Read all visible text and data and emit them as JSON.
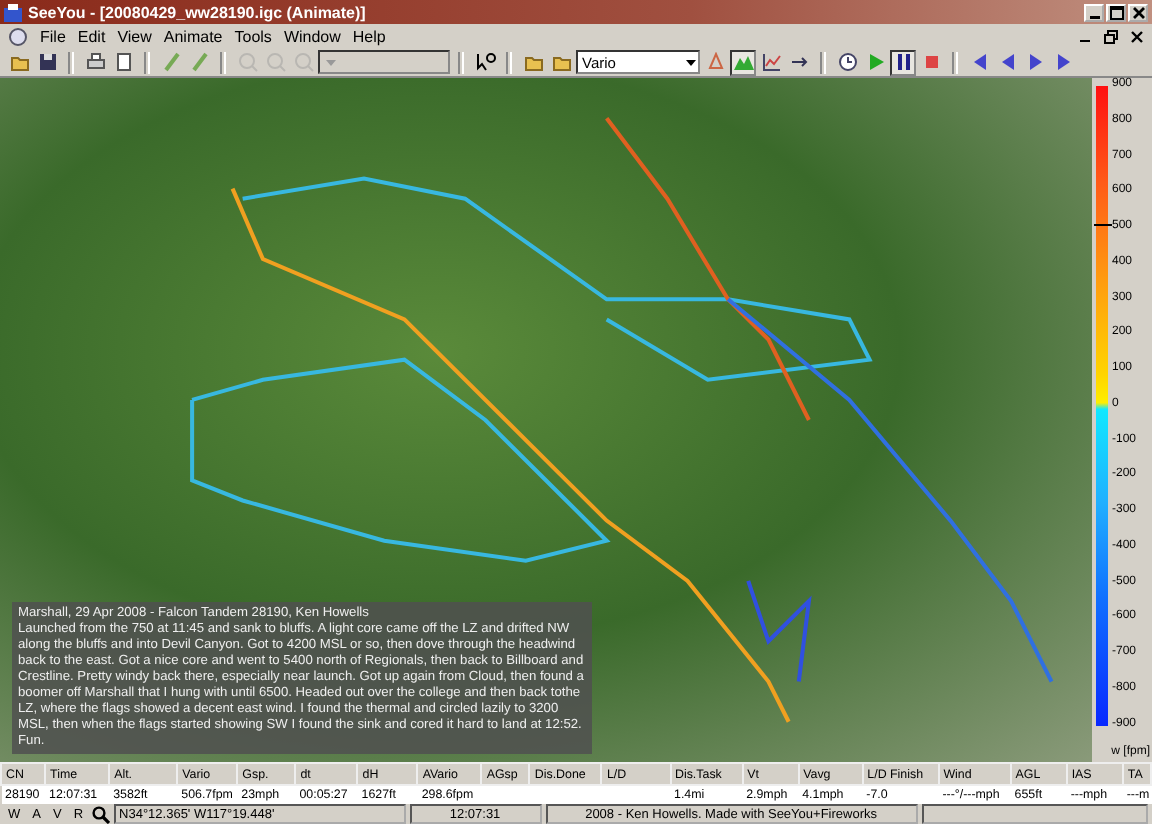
{
  "window": {
    "title": "SeeYou - [20080429_ww28190.igc (Animate)]"
  },
  "menu": [
    "File",
    "Edit",
    "View",
    "Animate",
    "Tools",
    "Window",
    "Help"
  ],
  "toolbar": {
    "zoom_tools": {
      "disabled": true
    },
    "location_dropdown": {
      "disabled": true
    },
    "mode_dropdown": {
      "value": "Vario"
    },
    "terrain_button": {
      "pressed": true
    },
    "pause_button": {
      "pressed": true
    }
  },
  "flight_note": {
    "title": "Marshall, 29 Apr 2008 - Falcon Tandem 28190, Ken Howells",
    "body": "Launched from the 750 at 11:45 and sank to bluffs.  A light core came off the LZ and drifted NW along the bluffs and into Devil Canyon.  Got to 4200 MSL or so, then dove through the headwind back to the east.  Got a nice core and went to 5400 north of Regionals, then back to Billboard and Crestline.  Pretty windy back there, especially near launch.  Got up again from Cloud, then found a boomer off Marshall that I hung with until 6500.  Headed out over the college and then back tothe LZ, where the flags showed a decent east wind.  I found the thermal and circled lazily to 3200 MSL, then when the flags started showing SW I found the sink and cored it hard to land at 12:52.  Fun."
  },
  "vario_scale": {
    "labels": [
      "900",
      "800",
      "700",
      "600",
      "500",
      "400",
      "300",
      "200",
      "100",
      "0",
      "-100",
      "-200",
      "-300",
      "-400",
      "-500",
      "-600",
      "-700",
      "-800",
      "-900"
    ],
    "unit": "w [fpm]",
    "level": 0.78
  },
  "table": {
    "columns": [
      "CN",
      "Time",
      "Alt.",
      "Vario",
      "Gsp.",
      "dt",
      "dH",
      "AVario",
      "AGsp",
      "Dis.Done",
      "L/D",
      "Dis.Task",
      "Vt",
      "Vavg",
      "L/D Finish",
      "Wind",
      "AGL",
      "IAS",
      "TA"
    ],
    "rows": [
      [
        "28190",
        "12:07:31",
        "3582ft",
        "506.7fpm",
        "23mph",
        "00:05:27",
        "1627ft",
        "298.6fpm",
        "",
        "",
        "",
        "1.4mi",
        "2.9mph",
        "4.1mph",
        "-7.0",
        "---°/---mph",
        "655ft",
        "---mph",
        "---m"
      ]
    ]
  },
  "status_bar": {
    "buttons": [
      "W",
      "A",
      "V",
      "R"
    ],
    "coordinates": "N34°12.365' W117°19.448'",
    "time": "12:07:31",
    "credit": "2008 - Ken Howells. Made with SeeYou+Fireworks"
  }
}
